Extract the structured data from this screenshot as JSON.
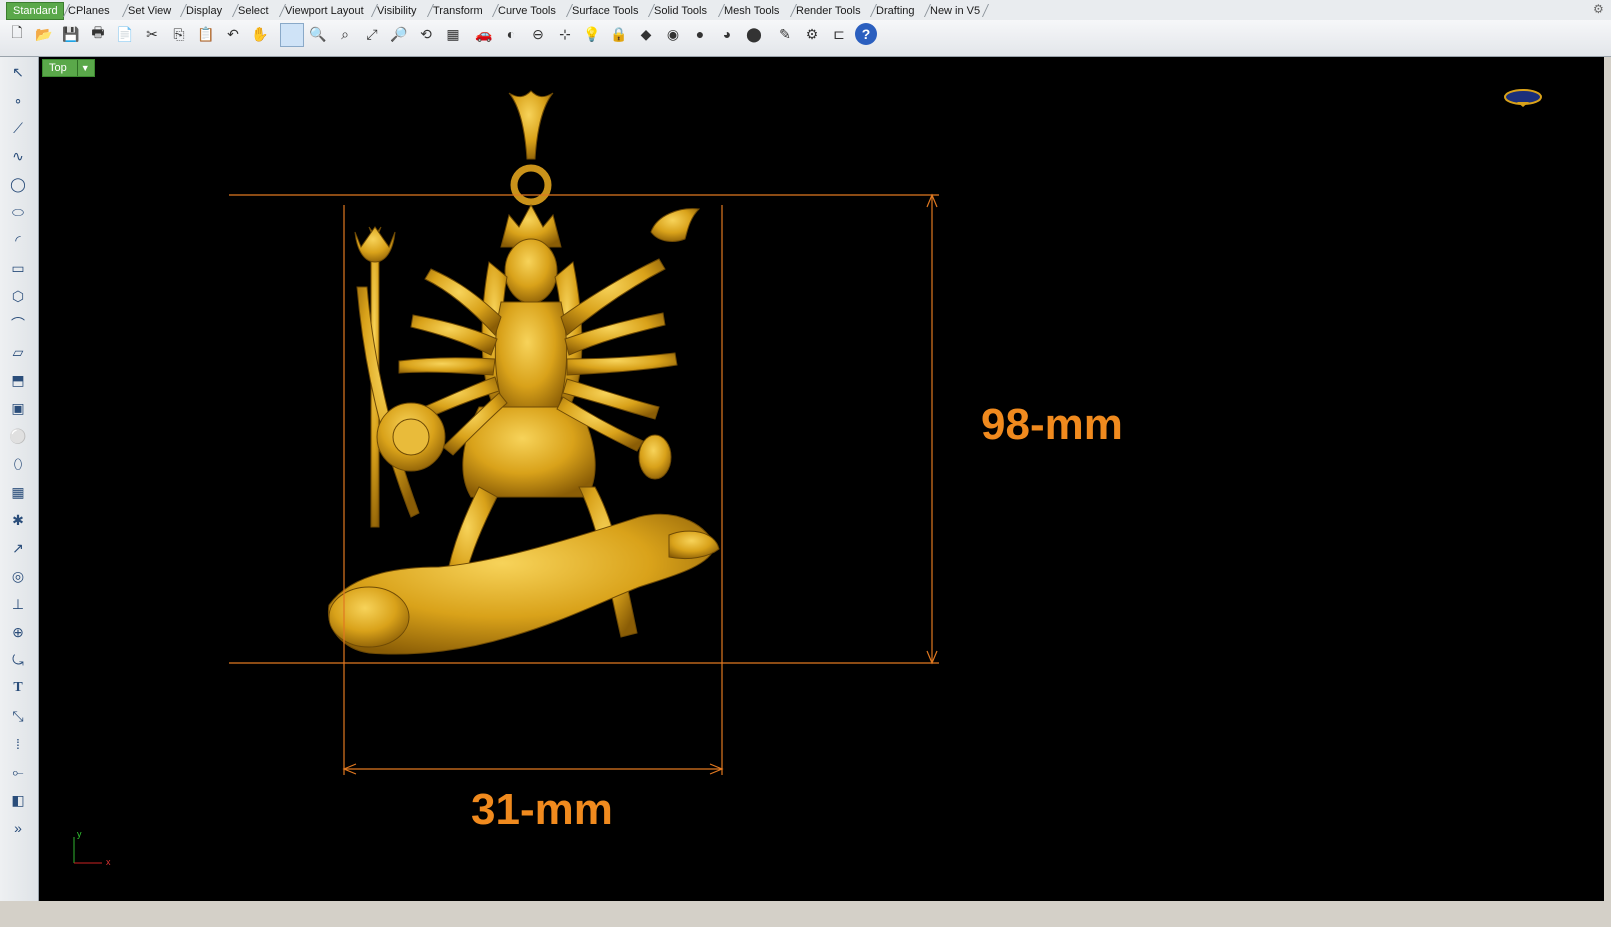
{
  "tabs": [
    "Standard",
    "CPlanes",
    "Set View",
    "Display",
    "Select",
    "Viewport Layout",
    "Visibility",
    "Transform",
    "Curve Tools",
    "Surface Tools",
    "Solid Tools",
    "Mesh Tools",
    "Render Tools",
    "Drafting",
    "New in V5"
  ],
  "active_tab": "Standard",
  "viewport": {
    "name": "Top"
  },
  "dimensions": {
    "width_label": "31-mm",
    "height_label": "98-mm"
  },
  "axes": {
    "x": "x",
    "y": "y"
  },
  "colors": {
    "background": "#000000",
    "dimension": "#f08a1e",
    "gold": "#d9a21a",
    "tab_active": "#5aa84a"
  },
  "toolbar_icons": [
    "new-icon",
    "open-icon",
    "save-icon",
    "print-icon",
    "import-icon",
    "cut-icon",
    "copy-icon",
    "paste-icon",
    "undo-icon",
    "pan-icon",
    "select-window-icon",
    "zoom-icon",
    "zoom-window-icon",
    "zoom-extents-icon",
    "zoom-selected-icon",
    "rotate-view-icon",
    "four-viewports-icon",
    "car-icon",
    "shade-icon",
    "cplane-icon",
    "object-snap-icon",
    "light-icon",
    "lock-icon",
    "layer-icon",
    "color-icon",
    "render-preview-icon",
    "sphere-icon",
    "material-icon",
    "options-icon",
    "gear-icon",
    "dimension-icon",
    "help-icon"
  ],
  "left_icons": [
    "select-arrow-icon",
    "point-icon",
    "polyline-icon",
    "curve-icon",
    "circle-icon",
    "ellipse-icon",
    "arc-icon",
    "rectangle-icon",
    "polygon-icon",
    "fillet-icon",
    "surface-icon",
    "extrude-icon",
    "box-icon",
    "sphere-icon",
    "cylinder-icon",
    "mesh-icon",
    "solid-tools-icon",
    "transform-icon",
    "boolean-icon",
    "split-icon",
    "join-icon",
    "rebuild-icon",
    "text-icon",
    "scale-icon",
    "array-icon",
    "analyze-icon",
    "render-icon",
    "more-icon"
  ]
}
